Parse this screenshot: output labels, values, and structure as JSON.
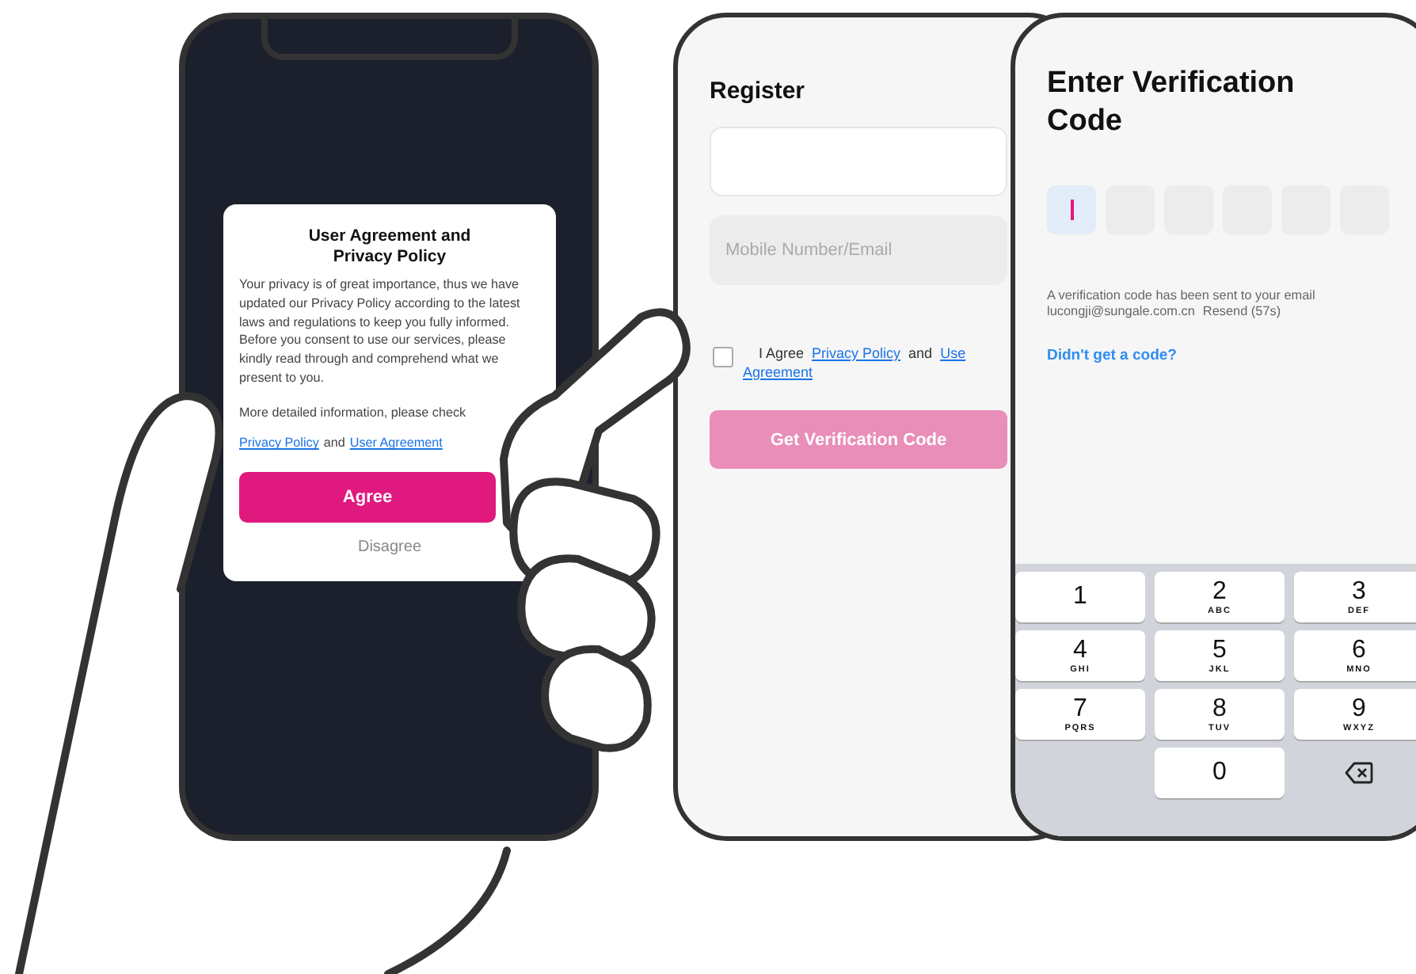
{
  "privacy_dialog": {
    "title": "User Agreement and Privacy Policy",
    "paragraphs": [
      "Your privacy is of great importance, thus we have updated our Privacy Policy according to the latest laws and regulations to keep you fully informed.",
      "Before you consent to use our services, please kindly read through and comprehend what we present to you."
    ],
    "check_note": "More detailed information, please check",
    "links": [
      {
        "text": "Privacy Policy",
        "kind": "link"
      },
      {
        "text": "and",
        "kind": "plain"
      },
      {
        "text": "User Agreement",
        "kind": "link"
      }
    ],
    "agree_button": "Agree",
    "disagree_button": "Disagree"
  },
  "register": {
    "title": "Register",
    "contact_field": {
      "placeholder": "Mobile Number/Email"
    },
    "agree_checkbox": {
      "checked": false
    },
    "agreement_text": [
      {
        "text": "I Agree",
        "kind": "plain"
      },
      {
        "text": "Privacy Policy",
        "kind": "link"
      },
      {
        "text": "and",
        "kind": "plain"
      },
      {
        "text": "Use",
        "kind": "link"
      },
      {
        "text": "Agreement",
        "kind": "link"
      }
    ],
    "submit_button": {
      "label": "Get Verification Code",
      "disabled": true
    }
  },
  "verification": {
    "title": "Enter Verification Code",
    "code_boxes": [
      {
        "focused": true
      },
      {
        "focused": false
      },
      {
        "focused": false
      },
      {
        "focused": false
      },
      {
        "focused": false
      },
      {
        "focused": false
      }
    ],
    "message": "A verification code has been sent to your email",
    "email": "lucongji@sungale.com.cn",
    "resend": "Resend (57s)",
    "help_link": "Didn't get a code?",
    "keypad": [
      {
        "kind": "digit",
        "digit": "1"
      },
      {
        "kind": "digit",
        "digit": "2",
        "letters": "ABC"
      },
      {
        "kind": "digit",
        "digit": "3",
        "letters": "DEF"
      },
      {
        "kind": "digit",
        "digit": "4",
        "letters": "GHI"
      },
      {
        "kind": "digit",
        "digit": "5",
        "letters": "JKL"
      },
      {
        "kind": "digit",
        "digit": "6",
        "letters": "MNO"
      },
      {
        "kind": "digit",
        "digit": "7",
        "letters": "PQRS"
      },
      {
        "kind": "digit",
        "digit": "8",
        "letters": "TUV"
      },
      {
        "kind": "digit",
        "digit": "9",
        "letters": "WXYZ"
      },
      {
        "kind": "blank"
      },
      {
        "kind": "digit",
        "digit": "0"
      },
      {
        "kind": "delete"
      }
    ]
  }
}
